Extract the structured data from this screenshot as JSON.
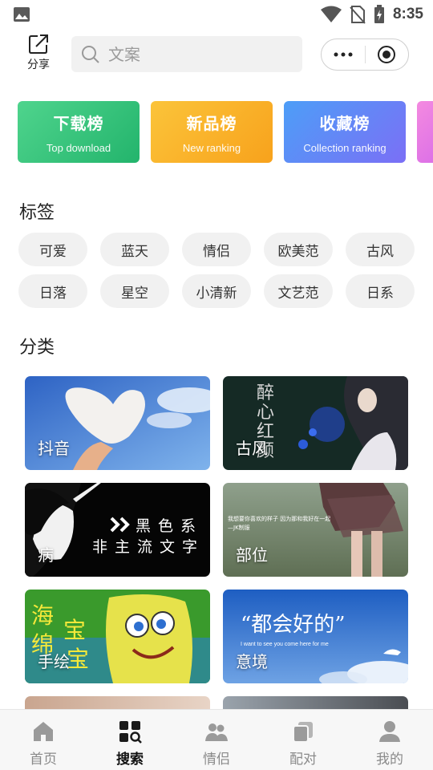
{
  "status_bar": {
    "time": "8:35",
    "icons": [
      "image-icon",
      "wifi-icon",
      "no-sim-icon",
      "battery-charging-icon"
    ]
  },
  "header": {
    "share_label": "分享",
    "search_placeholder": "文案",
    "capsule_icons": [
      "more-dots-icon",
      "target-circle-icon"
    ]
  },
  "rankings": [
    {
      "title": "下载榜",
      "subtitle": "Top download"
    },
    {
      "title": "新品榜",
      "subtitle": "New ranking"
    },
    {
      "title": "收藏榜",
      "subtitle": "Collection ranking"
    },
    {
      "title": "",
      "subtitle": ""
    }
  ],
  "tags_section": {
    "title": "标签",
    "tags": [
      "可爱",
      "蓝天",
      "情侣",
      "欧美范",
      "古风",
      "日落",
      "星空",
      "小清新",
      "文艺范",
      "日系"
    ]
  },
  "category_section": {
    "title": "分类",
    "items": [
      {
        "label": "抖音"
      },
      {
        "label": "古风"
      },
      {
        "label": "病",
        "overlay": [
          "黑",
          "色",
          "系",
          "非",
          "主",
          "流",
          "文",
          "字"
        ]
      },
      {
        "label": "部位",
        "overlay": "我想要你喜欢的样子 因为那和我好在一起 —JK制服"
      },
      {
        "label": "手绘",
        "overlay": [
          "海",
          "绵",
          "宝",
          "宝"
        ]
      },
      {
        "label": "意境",
        "overlay": "“都会好的”"
      }
    ],
    "overlay_glyphs": [
      "醉",
      "心",
      "红",
      "颜"
    ],
    "overlay_caption": "I want to see you come here for me"
  },
  "bottom_nav": {
    "items": [
      {
        "label": "首页",
        "icon": "home-icon",
        "active": false
      },
      {
        "label": "搜索",
        "icon": "search-grid-icon",
        "active": true
      },
      {
        "label": "情侣",
        "icon": "couple-icon",
        "active": false
      },
      {
        "label": "配对",
        "icon": "pair-icon",
        "active": false
      },
      {
        "label": "我的",
        "icon": "user-icon",
        "active": false
      }
    ]
  },
  "colors": {
    "download_card": "#23b46c",
    "new_card": "#f8a21c",
    "collection_card": "#4d9ef7",
    "tag_bg": "#f1f1f1",
    "nav_active": "#111111",
    "nav_inactive": "#8a8a8a"
  }
}
